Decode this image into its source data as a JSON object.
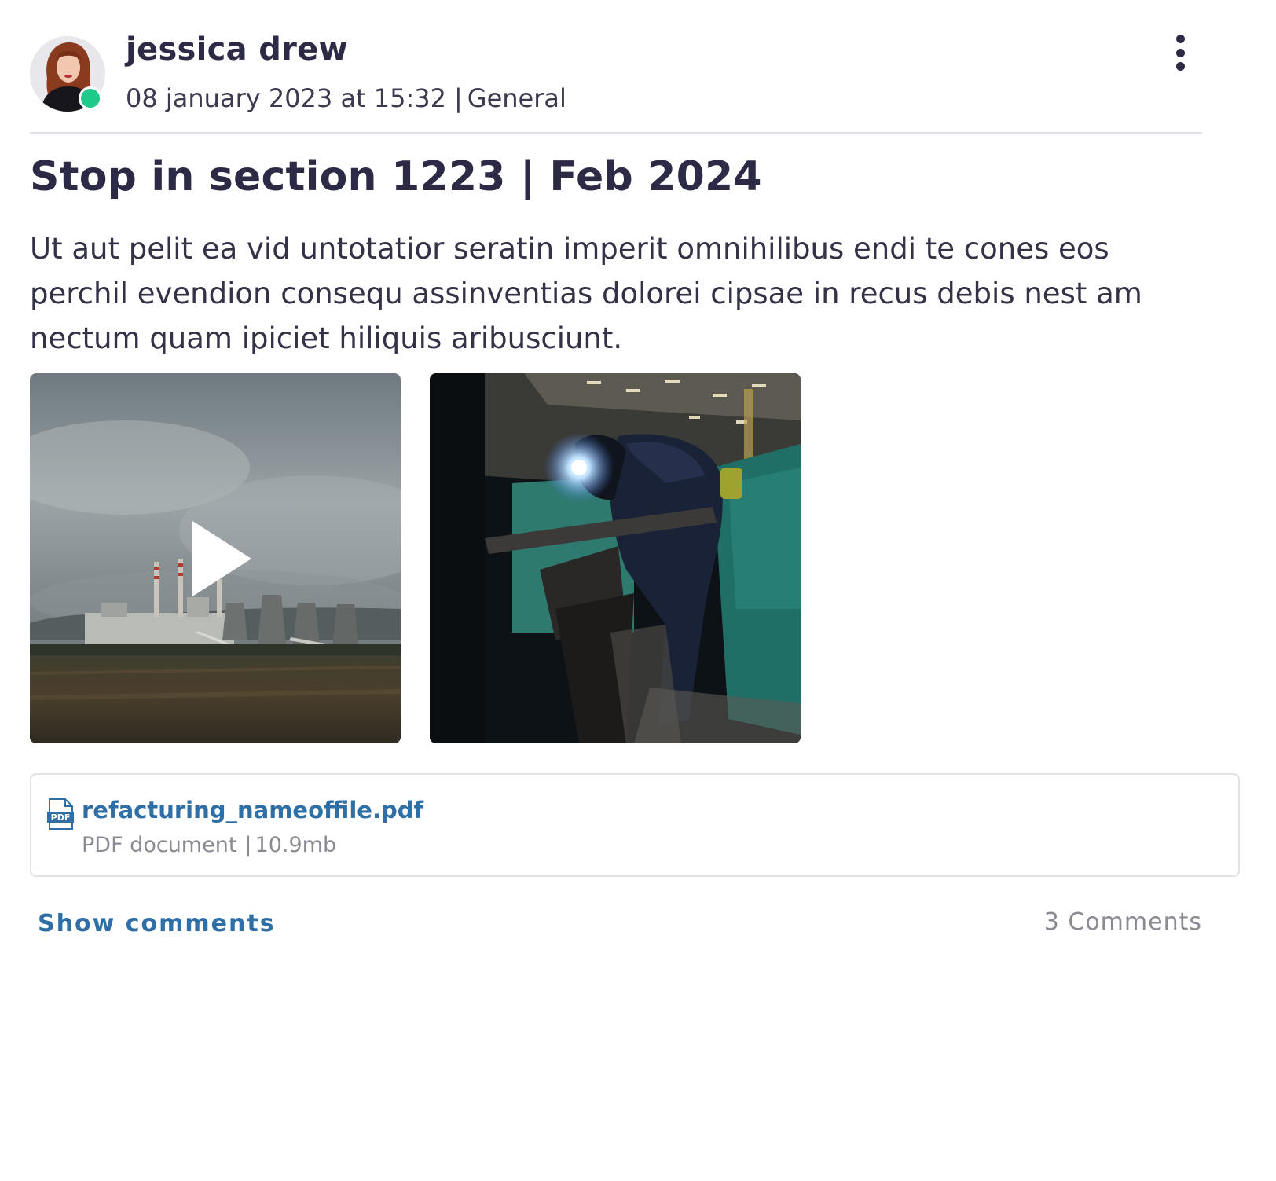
{
  "post": {
    "author": {
      "name": "jessica drew",
      "status_color": "#1fc98a",
      "avatar_icon": "woman-portrait-avatar"
    },
    "date": "08 january 2023 at 15:32",
    "meta_separator": "|",
    "category": "General",
    "menu_icon": "vertical-dots-icon",
    "title": "Stop in section 1223 | Feb 2024",
    "body": "Ut aut pelit ea vid untotatior seratin imperit omnihilibus endi te cones eos perchil evendion consequ assinventias dolorei cipsae in recus debis nest am nectum quam ipiciet hiliquis aribusciunt.",
    "media": [
      {
        "kind": "video",
        "icon": "play-icon",
        "subject": "power-plant-landscape"
      },
      {
        "kind": "image",
        "subject": "welder-in-factory"
      }
    ],
    "attachment": {
      "icon": "pdf-file-icon",
      "file_name": "refacturing_nameoffile.pdf",
      "file_type": "PDF document",
      "separator": "|",
      "file_size": "10.9mb"
    },
    "show_comments_label": "Show comments",
    "comment_count_label": "3 Comments"
  },
  "colors": {
    "text_primary": "#2c2a45",
    "link": "#2f6fa5",
    "muted": "#8a8a93",
    "online": "#1fc98a",
    "divider": "#dedee2"
  }
}
